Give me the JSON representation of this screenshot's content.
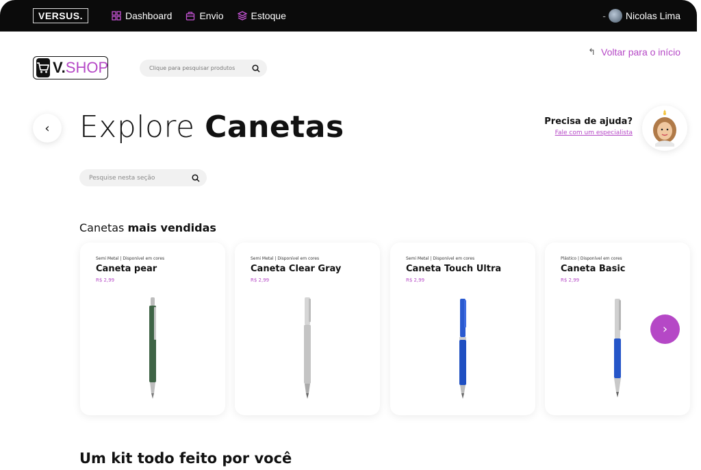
{
  "topbar": {
    "brand": "VERSUS.",
    "nav": [
      {
        "label": "Dashboard",
        "icon": "grid-icon"
      },
      {
        "label": "Envio",
        "icon": "box-icon"
      },
      {
        "label": "Estoque",
        "icon": "layers-icon"
      }
    ],
    "separator": "-",
    "user_name": "Nicolas Lima"
  },
  "header": {
    "logo_v": "V.",
    "logo_shop": "SHOP",
    "search_placeholder": "Clique para pesquisar produtos",
    "back_home": "Voltar para o início"
  },
  "page": {
    "title_light": "Explore ",
    "title_bold": "Canetas",
    "section_search_placeholder": "Pesquise nesta seção",
    "section_title_light": "Canetas ",
    "section_title_bold": "mais vendidas",
    "kit_title": "Um kit todo feito por você"
  },
  "help": {
    "question": "Precisa de ajuda?",
    "link": "Fale com um especialista"
  },
  "products": [
    {
      "meta": "Semi Metal | Disponível em cores",
      "name": "Caneta pear",
      "price": "R$ 2,99",
      "body_color": "#3f6446",
      "clip_color": "#c8c8c8"
    },
    {
      "meta": "Semi Metal | Disponível em cores",
      "name": "Caneta Clear Gray",
      "price": "R$ 2,99",
      "body_color": "#c4c4c4",
      "clip_color": "#dcdcdc"
    },
    {
      "meta": "Semi Metal | Disponível em cores",
      "name": "Caneta Touch Ultra",
      "price": "R$ 2,99",
      "body_color": "#1f4fc2",
      "clip_color": "#2a5ad0"
    },
    {
      "meta": "Plástico | Disponível em cores",
      "name": "Caneta Basic",
      "price": "R$ 2,99",
      "body_color": "#2555c8",
      "clip_color": "#cccccc"
    }
  ],
  "colors": {
    "accent": "#b548c6",
    "topbar": "#0b0b0b"
  }
}
